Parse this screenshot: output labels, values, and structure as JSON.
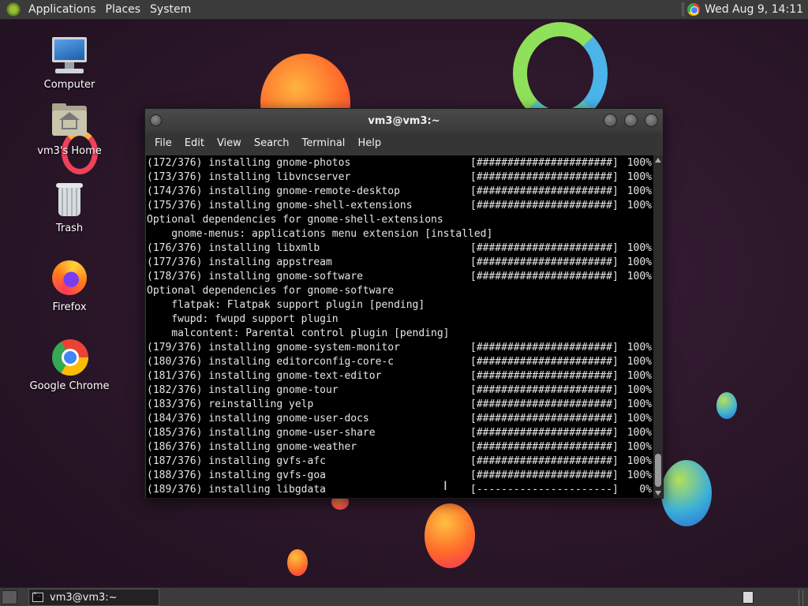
{
  "top_panel": {
    "menus": [
      "Applications",
      "Places",
      "System"
    ],
    "clock": "Wed Aug  9, 14:11"
  },
  "desktop_icons": [
    {
      "label": "Computer",
      "icon": "computer-icon"
    },
    {
      "label": "vm3's Home",
      "icon": "home-folder-icon"
    },
    {
      "label": "Trash",
      "icon": "trash-icon"
    },
    {
      "label": "Firefox",
      "icon": "firefox-icon"
    },
    {
      "label": "Google Chrome",
      "icon": "chrome-icon"
    }
  ],
  "terminal": {
    "title": "vm3@vm3:~",
    "menu": [
      "File",
      "Edit",
      "View",
      "Search",
      "Terminal",
      "Help"
    ],
    "lines": [
      {
        "msg": "(172/376) installing gnome-photos",
        "bar": "[######################]",
        "pct": "100%"
      },
      {
        "msg": "(173/376) installing libvncserver",
        "bar": "[######################]",
        "pct": "100%"
      },
      {
        "msg": "(174/376) installing gnome-remote-desktop",
        "bar": "[######################]",
        "pct": "100%"
      },
      {
        "msg": "(175/376) installing gnome-shell-extensions",
        "bar": "[######################]",
        "pct": "100%"
      },
      {
        "msg": "Optional dependencies for gnome-shell-extensions"
      },
      {
        "msg": "    gnome-menus: applications menu extension [installed]"
      },
      {
        "msg": "(176/376) installing libxmlb",
        "bar": "[######################]",
        "pct": "100%"
      },
      {
        "msg": "(177/376) installing appstream",
        "bar": "[######################]",
        "pct": "100%"
      },
      {
        "msg": "(178/376) installing gnome-software",
        "bar": "[######################]",
        "pct": "100%"
      },
      {
        "msg": "Optional dependencies for gnome-software"
      },
      {
        "msg": "    flatpak: Flatpak support plugin [pending]"
      },
      {
        "msg": "    fwupd: fwupd support plugin"
      },
      {
        "msg": "    malcontent: Parental control plugin [pending]"
      },
      {
        "msg": "(179/376) installing gnome-system-monitor",
        "bar": "[######################]",
        "pct": "100%"
      },
      {
        "msg": "(180/376) installing editorconfig-core-c",
        "bar": "[######################]",
        "pct": "100%"
      },
      {
        "msg": "(181/376) installing gnome-text-editor",
        "bar": "[######################]",
        "pct": "100%"
      },
      {
        "msg": "(182/376) installing gnome-tour",
        "bar": "[######################]",
        "pct": "100%"
      },
      {
        "msg": "(183/376) reinstalling yelp",
        "bar": "[######################]",
        "pct": "100%"
      },
      {
        "msg": "(184/376) installing gnome-user-docs",
        "bar": "[######################]",
        "pct": "100%"
      },
      {
        "msg": "(185/376) installing gnome-user-share",
        "bar": "[######################]",
        "pct": "100%"
      },
      {
        "msg": "(186/376) installing gnome-weather",
        "bar": "[######################]",
        "pct": "100%"
      },
      {
        "msg": "(187/376) installing gvfs-afc",
        "bar": "[######################]",
        "pct": "100%"
      },
      {
        "msg": "(188/376) installing gvfs-goa",
        "bar": "[######################]",
        "pct": "100%"
      },
      {
        "msg": "(189/376) installing libgdata",
        "bar": "[----------------------]",
        "pct": "0%"
      }
    ]
  },
  "taskbar": {
    "items": [
      {
        "label": "vm3@vm3:~"
      }
    ]
  }
}
